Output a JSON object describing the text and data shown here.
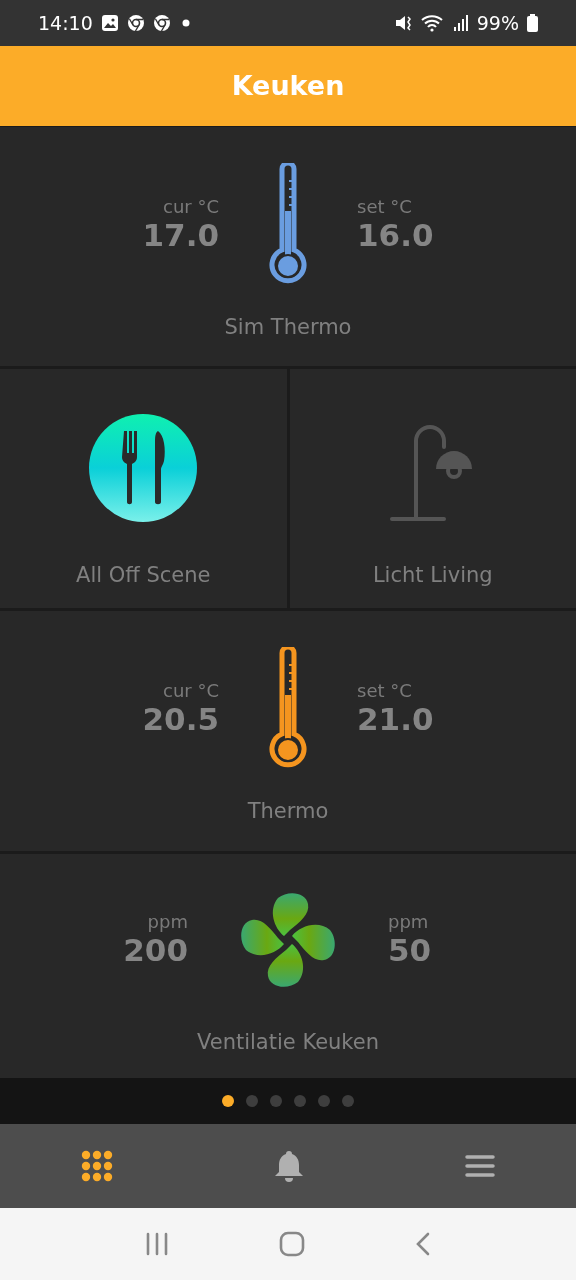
{
  "status_bar": {
    "time": "14:10",
    "battery": "99%"
  },
  "header": {
    "title": "Keuken"
  },
  "tiles": [
    {
      "kind": "thermostat",
      "wide": true,
      "color": "#6a9de0",
      "cur_label": "cur °C",
      "cur_value": "17.0",
      "set_label": "set °C",
      "set_value": "16.0",
      "name": "Sim Thermo"
    },
    {
      "kind": "scene",
      "wide": false,
      "name": "All Off Scene"
    },
    {
      "kind": "light",
      "wide": false,
      "on": false,
      "name": "Licht Living"
    },
    {
      "kind": "thermostat",
      "wide": true,
      "color": "#f5951f",
      "cur_label": "cur °C",
      "cur_value": "20.5",
      "set_label": "set °C",
      "set_value": "21.0",
      "name": "Thermo"
    },
    {
      "kind": "ventilation",
      "wide": true,
      "cur_label": "ppm",
      "cur_value": "200",
      "set_label": "ppm",
      "set_value": "50",
      "name": "Ventilatie Keuken"
    }
  ],
  "pages": [
    {
      "selected": true
    },
    {
      "selected": false
    },
    {
      "selected": false
    },
    {
      "selected": false
    },
    {
      "selected": false
    },
    {
      "selected": false
    }
  ],
  "nav": [
    {
      "kind": "dashboard",
      "selected": true
    },
    {
      "kind": "notifications",
      "selected": false
    },
    {
      "kind": "menu",
      "selected": false
    }
  ]
}
